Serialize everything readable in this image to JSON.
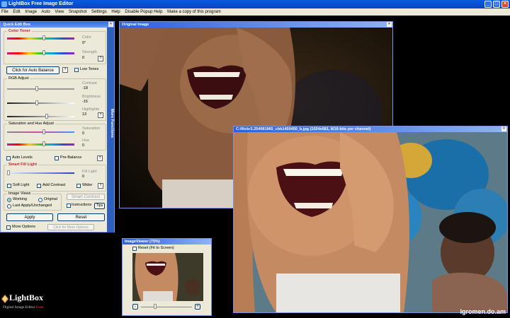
{
  "window": {
    "title": "LightBox Free Image Editor",
    "controls": {
      "minimize": "_",
      "maximize": "□",
      "close": "×"
    }
  },
  "menu": [
    "File",
    "Edit",
    "Image",
    "Auto",
    "View",
    "Snapshot",
    "Settings",
    "Help",
    "Disable Popup Help",
    "Make a copy of this program"
  ],
  "quick_edit": {
    "title": "Quick Edit Box",
    "side_tab": "More Functions",
    "color_toner": {
      "title": "Color Toner",
      "color_label": "Color",
      "color_value": "0°",
      "strength_label": "Strength",
      "strength_value": "0"
    },
    "auto_balance_button": "Click for Auto Balance",
    "help_glyph": "?",
    "low_tones": "Low Tones",
    "rgb": {
      "title": "RGB Adjust",
      "contrast_label": "Contrast",
      "contrast_value": "-18",
      "brightness_label": "Brightness",
      "brightness_value": "-15",
      "highlights_label": "Highlights",
      "highlights_value": "13"
    },
    "sat_hue": {
      "title": "Saturation and Hue Adjust",
      "saturation_label": "Saturation",
      "saturation_value": "0",
      "hue_label": "Hue",
      "hue_value": "0"
    },
    "auto_levels": "Auto Levels",
    "pre_balance": "Pre-Balance",
    "smart_fill": {
      "title": "Smart Fill Light",
      "fill_label": "Fill Light",
      "fill_value": "0",
      "soft_light": "Soft Light",
      "add_contrast": "Add Contrast",
      "wider": "Wider"
    },
    "image_views": {
      "title": "Image Views",
      "working": "Working",
      "original": "Original",
      "last_apply": "Last Apply/Unchanged",
      "selected": "Working"
    },
    "smart_contrast": "Smart Contrast",
    "instructions": "Instructions",
    "tips": "Tips",
    "apply": "Apply",
    "reset": "Reset",
    "more_options": "More Options",
    "more_options_btn": "Click for More Options"
  },
  "original_window": {
    "title": "Original Image",
    "close": "×"
  },
  "working_window": {
    "title": "C:\\flickr3.254081965_cbb1450450_b.jpg (1024x681, 8/16-bits per channel)",
    "close": "×"
  },
  "image_viewer": {
    "title": "ImageViewer (75%)",
    "reset_fit": "Reset (Fit to Screen)",
    "minus": "-",
    "plus": "+",
    "zoom_percent": 75
  },
  "logo": {
    "title": "LightBox",
    "subtitle": "Digital Image Editor",
    "free": "Free"
  },
  "watermark": "Igromen.do.am"
}
